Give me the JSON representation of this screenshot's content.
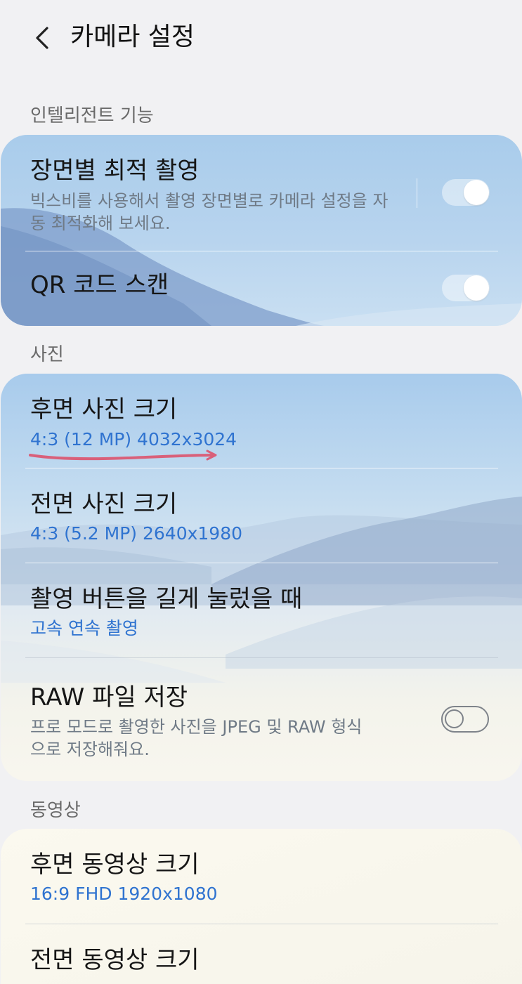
{
  "header": {
    "title": "카메라 설정"
  },
  "sections": {
    "intelligent": "인텔리전트 기능",
    "photo": "사진",
    "video": "동영상"
  },
  "intelligent": {
    "scene_optimizer": {
      "title": "장면별 최적 촬영",
      "subtitle": "빅스비를 사용해서 촬영 장면별로 카메라 설정을 자동 최적화해 보세요.",
      "enabled": true
    },
    "qr_scan": {
      "title": "QR 코드 스캔",
      "enabled": true
    }
  },
  "photo": {
    "rear_size": {
      "title": "후면 사진 크기",
      "value": "4:3 (12 MP) 4032x3024"
    },
    "front_size": {
      "title": "전면 사진 크기",
      "value": "4:3 (5.2 MP) 2640x1980"
    },
    "hold_shutter": {
      "title": "촬영 버튼을 길게 눌렀을 때",
      "value": "고속 연속 촬영"
    },
    "raw": {
      "title": "RAW 파일 저장",
      "subtitle": "프로 모드로 촬영한 사진을 JPEG 및 RAW 형식으로 저장해줘요.",
      "enabled": false
    }
  },
  "video": {
    "rear_size": {
      "title": "후면 동영상 크기",
      "value": "16:9 FHD 1920x1080"
    },
    "front_size": {
      "title": "전면 동영상 크기"
    }
  },
  "colors": {
    "accent_value": "#2f73d0",
    "annotation_underline": "#d9607a",
    "background": "#f1f1f3"
  },
  "icons": {
    "back": "chevron-left-icon"
  }
}
